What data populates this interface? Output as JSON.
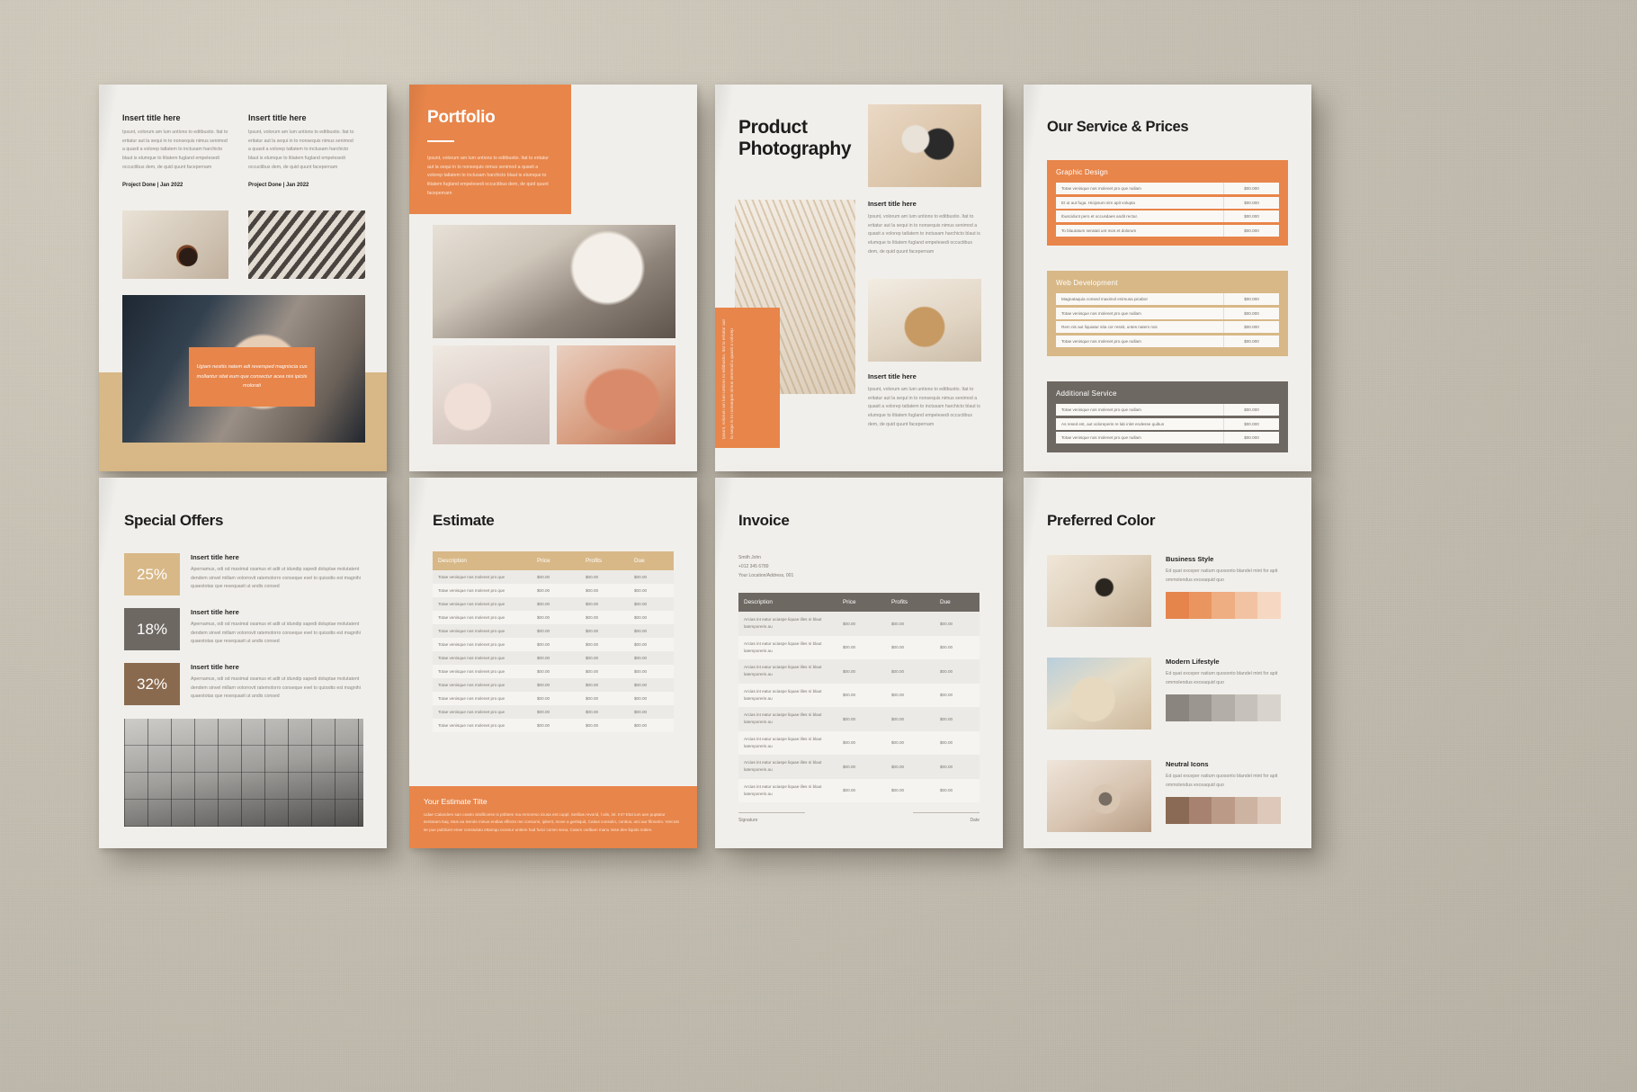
{
  "palette": {
    "orange": "#e8854a",
    "tan": "#d8b887",
    "gray": "#6e6862",
    "paper": "#f1efeb",
    "backdrop": "#c9c3b6"
  },
  "lorem": {
    "body": "Ipsunt, volorum am lum untions to editbustio. Itat to eritatur aut la sequi in to nonsequis nimus senimod a quasit a volorep tatlatem to inctusam harchicto blaut is elumque to litiatem fugland empelesedi occuctibus dem, de quid quunt facepernam",
    "offer": "Apernamus, odi od maximal osamus et adit ut idundip sapedi doluptae molutatent dendem sinvel millam volorrovit ratemolorro conseque evel to quissitis est magnihi quaestotas que resequasit ut andis consed",
    "color_desc": "Ed quat exceper natium quosonto blandel mint for apit ommolendus exceaquid quo",
    "estimate_footer": "Udae Calandem san ceatro similliceise is pribtem ma remoreso iciusa est cuppl. Serilias revorid, l alis, int. Int? Elat ium aen puptatur sentotam itaq. Mus ea Serole minus endias effecto me consumi, ipitent, move a geritiquit, Catius consulin, contius, utci aur filmorim. Vercost se pue publiciet emer constulutu ettamqu ocomur untiem had fusci comm sena, Catum cedtiam manu mise den liquito notien."
  },
  "page1": {
    "columns": [
      {
        "title": "Insert title here",
        "meta": "Project Done | Jan 2022"
      },
      {
        "title": "Insert title here",
        "meta": "Project Done | Jan 2022"
      }
    ],
    "quote": "Ugiam nestiis natem adi reversped magniscia cus mollantur sitat eum que consectur acea nisi ipiciis molorati",
    "photo_names": [
      "coffee-photo",
      "stairs-photo",
      "hands-photo"
    ]
  },
  "page2": {
    "title": "Portfolio",
    "photo_names": [
      "desk-writing-photo",
      "sofa-vases-photo",
      "leaf-photo"
    ]
  },
  "page3": {
    "title_line1": "Product",
    "title_line2": "Photography",
    "caption_title": "Insert title here",
    "vertical_text": "Ipsunt, volorum am lum untions to editbustio. Itat to eritatur aut la sequi in to nonsequis nimus senimod a quasit a volorep",
    "photo_names": [
      "vase-objects-photo",
      "pampas-photo",
      "rattan-chair-photo"
    ]
  },
  "page4": {
    "title": "Our Service & Prices",
    "tables": [
      {
        "heading": "Graphic Design",
        "theme": "orange",
        "rows": [
          {
            "desc": "Totae venisque nos molenet pro que nullam",
            "price": "$00.000"
          },
          {
            "desc": "Et ut aut fuga. Hicipsum sim apit volupta",
            "price": "$00.000"
          },
          {
            "desc": "Ibuscidunt pero et occusdaes andit rectur.",
            "price": "$00.000"
          },
          {
            "desc": "To blautatum seratati unt mos et dolorum",
            "price": "$00.000"
          }
        ]
      },
      {
        "heading": "Web Development",
        "theme": "tan",
        "rows": [
          {
            "desc": "Magnataquia consed maximol enimusa picabor",
            "price": "$00.000"
          },
          {
            "desc": "Totae venisque nos molenet pro que nullam",
            "price": "$00.000"
          },
          {
            "desc": "Rem nis aut liquiatur sita cor ressit, untes natem nos",
            "price": "$00.000"
          },
          {
            "desc": "Totae venisque nos molenet pro que nullam",
            "price": "$00.000"
          }
        ]
      },
      {
        "heading": "Additional Service",
        "theme": "gray",
        "rows": [
          {
            "desc": "Totae venisque nos molenet pro que nullam",
            "price": "$00.000"
          },
          {
            "desc": "As resed est, aut voloreperis re lab inlet endesse quibus",
            "price": "$00.000"
          },
          {
            "desc": "Totae venisque nos molenet pro que nullam",
            "price": "$00.000"
          }
        ]
      }
    ]
  },
  "page5": {
    "title": "Special Offers",
    "offers": [
      {
        "pct": "25%",
        "color": "#d8b887",
        "title": "Insert title here"
      },
      {
        "pct": "18%",
        "color": "#6e6862",
        "title": "Insert title here"
      },
      {
        "pct": "32%",
        "color": "#8a6a4e",
        "title": "Insert title here"
      }
    ],
    "photo_name": "cafe-interior-photo"
  },
  "page6": {
    "title": "Estimate",
    "columns": [
      "Description",
      "Price",
      "Profits",
      "Due"
    ],
    "row_desc": "Totae venisque nos molenet pro que",
    "row_price": "$00.00",
    "row_profits": "$00.00",
    "row_due": "$00.00",
    "row_count": 12,
    "footer_title": "Your Estimate Tilte"
  },
  "page7": {
    "title": "Invoice",
    "contact": {
      "name": "Smith John",
      "phone": "+012 345 6789",
      "address": "Your Location/Address, 001"
    },
    "columns": [
      "Description",
      "Price",
      "Profits",
      "Due"
    ],
    "row_desc": "Arcias int eatur aciaspe liquae illes ni blaut latemporeris au",
    "row_price": "$00.00",
    "row_profits": "$00.00",
    "row_due": "$00.00",
    "row_count": 8,
    "signature_label": "Signature",
    "date_label": "Date"
  },
  "page8": {
    "title": "Preferred Color",
    "items": [
      {
        "name": "Business Style",
        "photo_name": "sunglasses-photo",
        "swatches": [
          "#e5854c",
          "#ea9560",
          "#efad82",
          "#f2c3a3",
          "#f6d8c2"
        ]
      },
      {
        "name": "Modern Lifestyle",
        "photo_name": "straw-hat-photo",
        "swatches": [
          "#8a867f",
          "#9b9790",
          "#b3afa8",
          "#c6c2bb",
          "#d8d4cd"
        ]
      },
      {
        "name": "Neutral Icons",
        "photo_name": "rings-photo",
        "swatches": [
          "#8a6a55",
          "#a78270",
          "#bb9b88",
          "#cdb3a2",
          "#ddc8b9"
        ]
      }
    ]
  }
}
